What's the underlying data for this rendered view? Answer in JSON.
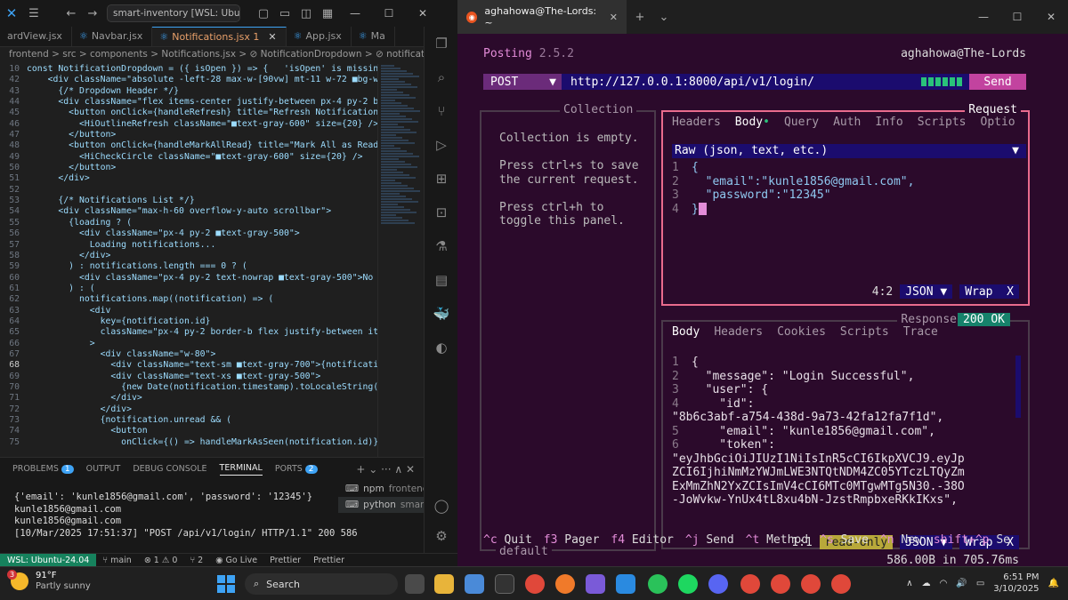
{
  "vscode": {
    "search_text": "smart-inventory [WSL: Ubuntu-24.0",
    "tabs": [
      {
        "label": "ardView.jsx",
        "icon": "JS"
      },
      {
        "label": "Navbar.jsx",
        "icon": "JS"
      },
      {
        "label": "Notifications.jsx 1",
        "icon": "JS",
        "active": true
      },
      {
        "label": "App.jsx",
        "icon": "JS"
      },
      {
        "label": "Ma",
        "icon": "JS"
      }
    ],
    "breadcrumb": "frontend > src > components > Notifications.jsx > ⊘ NotificationDropdown > ⊘ notifications.map",
    "code_lines": [
      {
        "no": "10",
        "text": "const NotificationDropdown = ({ isOpen }) => {   'isOpen' is missing i"
      },
      {
        "no": "42",
        "text": "    <div className=\"absolute -left-28 max-w-[90vw] mt-11 w-72 ■bg-whit"
      },
      {
        "no": "43",
        "text": "      {/* Dropdown Header */}"
      },
      {
        "no": "44",
        "text": "      <div className=\"flex items-center justify-between px-4 py-2 borde"
      },
      {
        "no": "45",
        "text": "        <button onClick={handleRefresh} title=\"Refresh Notifications\">"
      },
      {
        "no": "46",
        "text": "          <HiOutlineRefresh className=\"■text-gray-600\" size={20} />"
      },
      {
        "no": "47",
        "text": "        </button>"
      },
      {
        "no": "48",
        "text": "        <button onClick={handleMarkAllRead} title=\"Mark All as Read\">"
      },
      {
        "no": "49",
        "text": "          <HiCheckCircle className=\"■text-gray-600\" size={20} />"
      },
      {
        "no": "50",
        "text": "        </button>"
      },
      {
        "no": "51",
        "text": "      </div>"
      },
      {
        "no": "52",
        "text": ""
      },
      {
        "no": "53",
        "text": "      {/* Notifications List */}"
      },
      {
        "no": "54",
        "text": "      <div className=\"max-h-60 overflow-y-auto scrollbar\">"
      },
      {
        "no": "55",
        "text": "        {loading ? ("
      },
      {
        "no": "56",
        "text": "          <div className=\"px-4 py-2 ■text-gray-500\">"
      },
      {
        "no": "57",
        "text": "            Loading notifications..."
      },
      {
        "no": "58",
        "text": "          </div>"
      },
      {
        "no": "59",
        "text": "        ) : notifications.length === 0 ? ("
      },
      {
        "no": "60",
        "text": "          <div className=\"px-4 py-2 text-nowrap ■text-gray-500\">No not"
      },
      {
        "no": "61",
        "text": "        ) : ("
      },
      {
        "no": "62",
        "text": "          notifications.map((notification) => ("
      },
      {
        "no": "63",
        "text": "            <div"
      },
      {
        "no": "64",
        "text": "              key={notification.id}"
      },
      {
        "no": "65",
        "text": "              className=\"px-4 py-2 border-b flex justify-between items-"
      },
      {
        "no": "66",
        "text": "            >"
      },
      {
        "no": "67",
        "text": "              <div className=\"w-80\">"
      },
      {
        "no": "68",
        "text": "                <div className=\"text-sm ■text-gray-700\">{notification."
      },
      {
        "no": "69",
        "text": "                <div className=\"text-xs ■text-gray-500\">"
      },
      {
        "no": "70",
        "text": "                  {new Date(notification.timestamp).toLocaleString()}"
      },
      {
        "no": "71",
        "text": "                </div>"
      },
      {
        "no": "72",
        "text": "              </div>"
      },
      {
        "no": "73",
        "text": "              {notification.unread && ("
      },
      {
        "no": "74",
        "text": "                <button"
      },
      {
        "no": "75",
        "text": "                  onClick={() => handleMarkAsSeen(notification.id)}"
      }
    ],
    "panel_tabs": {
      "problems": "PROBLEMS",
      "problems_count": "1",
      "output": "OUTPUT",
      "debug": "DEBUG CONSOLE",
      "terminal": "TERMINAL",
      "ports": "PORTS",
      "ports_count": "2"
    },
    "terminal_text": "{'email': 'kunle1856@gmail.com', 'password': '12345'}\nkunle1856@gmail.com\nkunle1856@gmail.com\n[10/Mar/2025 17:51:37] \"POST /api/v1/login/ HTTP/1.1\" 200 586",
    "terminal_list": [
      {
        "name": "npm",
        "sub": "frontend"
      },
      {
        "name": "python",
        "sub": "smar..."
      }
    ],
    "status": {
      "remote": "WSL: Ubuntu-24.04",
      "branch": "main",
      "errors": "⊗ 1 ⚠ 0",
      "ports": "⑂ 2",
      "golive": "Go Live",
      "prettier1": "Prettier",
      "prettier2": "Prettier"
    }
  },
  "terminal_window": {
    "tab_title": "aghahowa@The-Lords: ~",
    "posting": {
      "name": "Posting",
      "version": "2.5.2",
      "user": "aghahowa@The-Lords",
      "method": "POST",
      "url": "http://127.0.0.1:8000/api/v1/login/",
      "send": "Send",
      "collection_title": "Collection",
      "collection_body": "Collection is empty.\n\nPress ctrl+s to save\nthe current request.\n\nPress ctrl+h to\ntoggle this panel.",
      "collection_footer": "default",
      "request_title": "Request",
      "request_tabs": [
        "Headers",
        "Body",
        "Query",
        "Auth",
        "Info",
        "Scripts",
        "Optio"
      ],
      "body_type": "Raw (json, text, etc.)",
      "request_body": [
        {
          "n": "1",
          "t": "{"
        },
        {
          "n": "2",
          "t": "  \"email\":\"kunle1856@gmail.com\","
        },
        {
          "n": "3",
          "t": "  \"password\":\"12345\""
        },
        {
          "n": "4",
          "t": "}"
        }
      ],
      "request_pos": "4:2",
      "request_lang": "JSON",
      "request_wrap": "Wrap",
      "wrap_x": "X",
      "response_title": "Response",
      "response_status": "200 OK",
      "response_tabs": [
        "Body",
        "Headers",
        "Cookies",
        "Scripts",
        "Trace"
      ],
      "response_body": [
        {
          "n": "1",
          "t": "{"
        },
        {
          "n": "2",
          "t": "  \"message\": \"Login Successful\","
        },
        {
          "n": "3",
          "t": "  \"user\": {"
        },
        {
          "n": "4",
          "t": "    \"id\":"
        },
        {
          "n": "",
          "t": "\"8b6c3abf-a754-438d-9a73-42fa12fa7f1d\","
        },
        {
          "n": "5",
          "t": "    \"email\": \"kunle1856@gmail.com\","
        },
        {
          "n": "6",
          "t": "    \"token\":"
        },
        {
          "n": "",
          "t": "\"eyJhbGciOiJIUzI1NiIsInR5cCI6IkpXVCJ9.eyJp"
        },
        {
          "n": "",
          "t": "ZCI6IjhiNmMzYWJmLWE3NTQtNDM4ZC05YTczLTQyZm"
        },
        {
          "n": "",
          "t": "ExMmZhN2YxZCIsImV4cCI6MTc0MTgwMTg5N30.-38O"
        },
        {
          "n": "",
          "t": "-JoWvkw-YnUx4tL8xu4bN-JzstRmpbxeRKkIKxs\","
        }
      ],
      "response_pos": "1:1",
      "response_readonly": "read-only",
      "response_lang": "JSON",
      "response_wrap": "Wrap",
      "response_meta": "586.00B in 705.76ms",
      "keybinds": [
        {
          "k": "^c",
          "l": "Quit"
        },
        {
          "k": "f3",
          "l": "Pager"
        },
        {
          "k": "f4",
          "l": "Editor"
        },
        {
          "k": "^j",
          "l": "Send"
        },
        {
          "k": "^t",
          "l": "Method"
        },
        {
          "k": "^s",
          "l": "Save"
        },
        {
          "k": "^n",
          "l": "New"
        },
        {
          "k": "shift+^p",
          "l": "Se"
        }
      ]
    }
  },
  "taskbar": {
    "weather_temp": "91°F",
    "weather_cond": "Partly sunny",
    "weather_badge": "3",
    "search": "Search",
    "time": "6:51 PM",
    "date": "3/10/2025"
  }
}
